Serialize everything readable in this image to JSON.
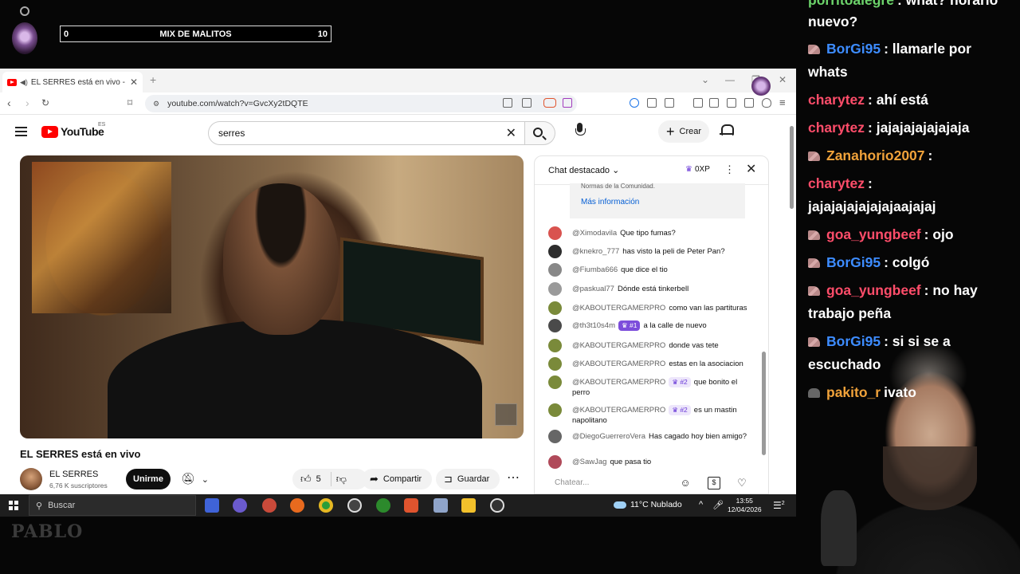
{
  "overlay": {
    "left_value": "0",
    "title": "MIX DE MALITOS",
    "right_value": "10"
  },
  "browser": {
    "tab_title": "EL SERRES está en vivo - YouTube",
    "url": "youtube.com/watch?v=GvcXy2tDQTE"
  },
  "youtube": {
    "logo": "YouTube",
    "region": "ES",
    "search_value": "serres",
    "create_label": "Crear"
  },
  "video": {
    "title": "EL SERRES está en vivo",
    "channel": "EL SERRES",
    "subscribers": "6,76 K suscriptores",
    "join_label": "Unirme",
    "likes": "5",
    "share_label": "Compartir",
    "save_label": "Guardar"
  },
  "live_chat": {
    "title": "Chat destacado",
    "xp": "0XP",
    "norms_text": "Normas de la Comunidad.",
    "more_info": "Más información",
    "input_placeholder": "Chatear...",
    "messages": [
      {
        "author": "@Ximodavila",
        "text": "Que tipo fumas?",
        "badge": "",
        "avatar_color": "#d9534f"
      },
      {
        "author": "@knekro_777",
        "text": "has visto la peli de Peter Pan?",
        "badge": "",
        "avatar_color": "#2d2d2d"
      },
      {
        "author": "@Fiumba666",
        "text": "que dice el tio",
        "badge": "",
        "avatar_color": "#888888"
      },
      {
        "author": "@paskual77",
        "text": "Dónde está tinkerbell",
        "badge": "",
        "avatar_color": "#9a9a9a"
      },
      {
        "author": "@KABOUTERGAMERPRO",
        "text": "como van las partituras",
        "badge": "",
        "avatar_color": "#7a8a3a"
      },
      {
        "author": "@th3t10s4m",
        "text": "a la calle de nuevo",
        "badge": "#1",
        "avatar_color": "#4a4a4a"
      },
      {
        "author": "@KABOUTERGAMERPRO",
        "text": "donde vas tete",
        "badge": "",
        "avatar_color": "#7a8a3a"
      },
      {
        "author": "@KABOUTERGAMERPRO",
        "text": "estas en la asociacion",
        "badge": "",
        "avatar_color": "#7a8a3a"
      },
      {
        "author": "@KABOUTERGAMERPRO",
        "text": "que bonito el perro",
        "badge": "#2",
        "avatar_color": "#7a8a3a"
      },
      {
        "author": "@KABOUTERGAMERPRO",
        "text": "es un mastin napolitano",
        "badge": "#2",
        "avatar_color": "#7a8a3a"
      },
      {
        "author": "@DiegoGuerreroVera",
        "text": "Has cagado hoy bien amigo?",
        "badge": "",
        "avatar_color": "#666666"
      },
      {
        "author": "@SawJag",
        "text": "que pasa tio",
        "badge": "",
        "avatar_color": "#b04a5a"
      }
    ]
  },
  "taskbar": {
    "search_placeholder": "Buscar",
    "weather": "11°C  Nublado",
    "time": "13:55",
    "date": "12/04/2026",
    "notif_count": "2"
  },
  "stream_chat": {
    "lines": [
      {
        "user": "porritoalegre",
        "text": ": what? horario",
        "color": "#6cd36a",
        "icon": ""
      },
      {
        "user": "",
        "text": "nuevo?",
        "color": "#ffffff",
        "icon": ""
      },
      {
        "user": "BorGi95",
        "text": ": llamarle por",
        "color": "#3d8cff",
        "icon": "hat"
      },
      {
        "user": "",
        "text": "whats",
        "color": "#ffffff",
        "icon": ""
      },
      {
        "user": "charytez",
        "text": ": ahí está",
        "color": "#ff4d6a",
        "icon": ""
      },
      {
        "user": "charytez",
        "text": ": jajajajajajajaja",
        "color": "#ff4d6a",
        "icon": ""
      },
      {
        "user": "Zanahorio2007",
        "text": ":",
        "color": "#f0a23a",
        "icon": "hat"
      },
      {
        "user": "charytez",
        "text": ":",
        "color": "#ff4d6a",
        "icon": ""
      },
      {
        "user": "",
        "text": "jajajajajajajajaajajaj",
        "color": "#ffffff",
        "icon": ""
      },
      {
        "user": "goa_yungbeef",
        "text": ": ojo",
        "color": "#ff4d6a",
        "icon": "hat"
      },
      {
        "user": "BorGi95",
        "text": ": colgó",
        "color": "#3d8cff",
        "icon": "hat"
      },
      {
        "user": "goa_yungbeef",
        "text": ": no hay",
        "color": "#ff4d6a",
        "icon": "hat"
      },
      {
        "user": "",
        "text": "trabajo peña",
        "color": "#ffffff",
        "icon": ""
      },
      {
        "user": "BorGi95",
        "text": ": si si se a",
        "color": "#3d8cff",
        "icon": "hat"
      },
      {
        "user": "",
        "text": "escuchado",
        "color": "#ffffff",
        "icon": ""
      },
      {
        "user": "pakito_r",
        "text": "ivato",
        "color": "#f0a23a",
        "icon": "hood"
      }
    ]
  },
  "stream_logo": "PABLO"
}
